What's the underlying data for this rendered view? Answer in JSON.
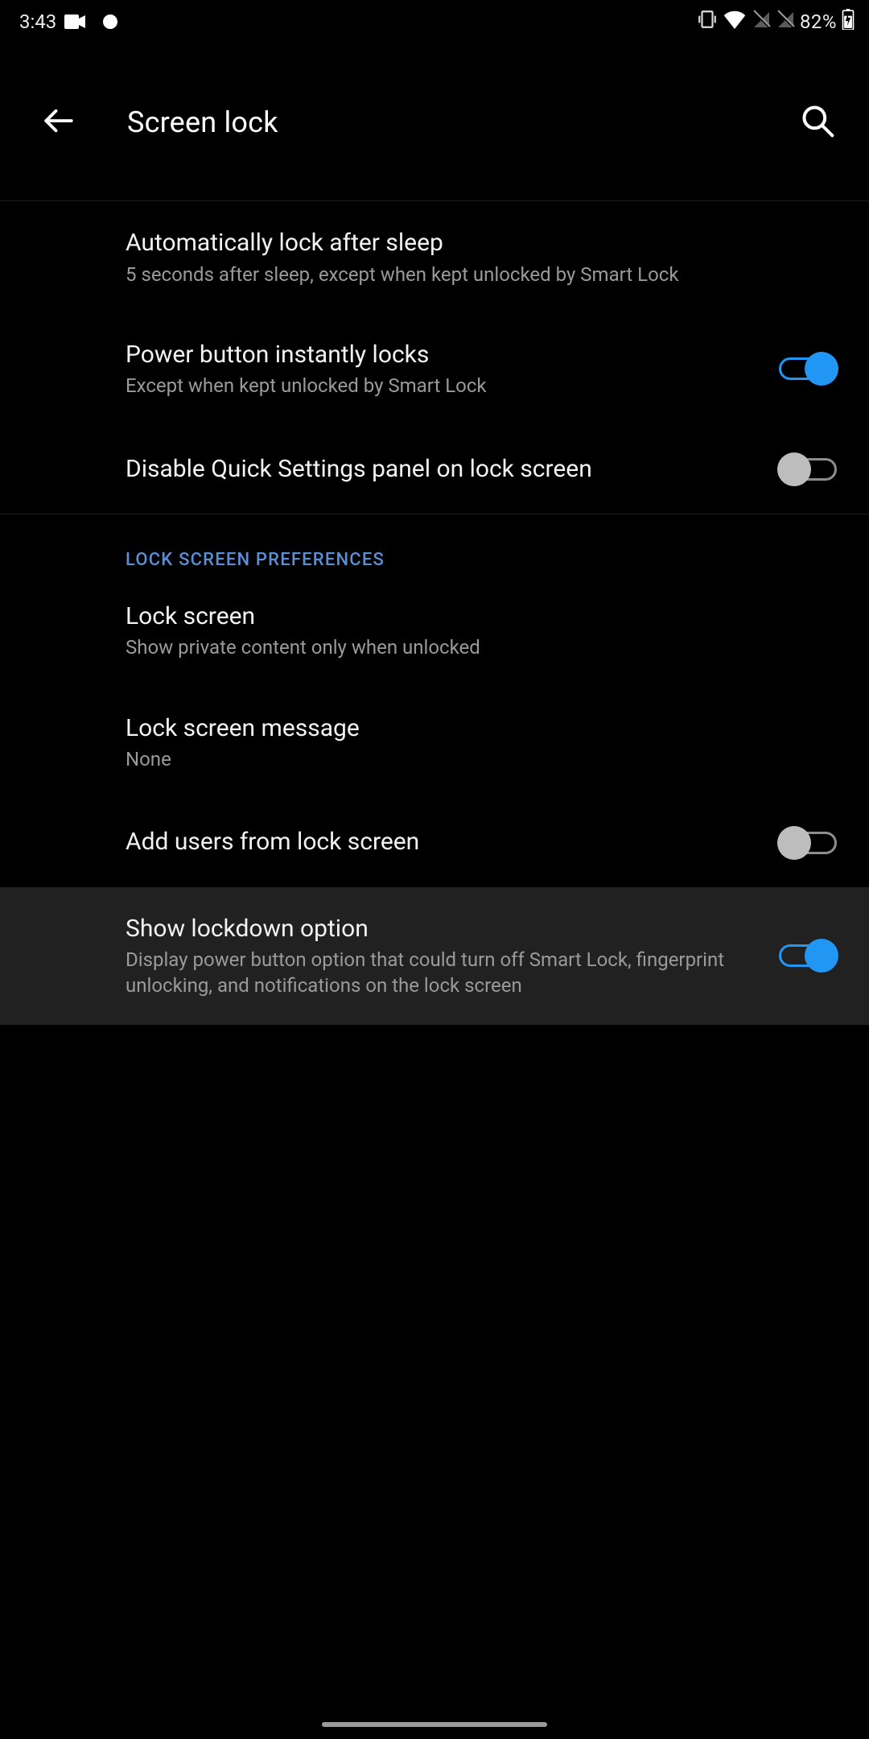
{
  "status_bar": {
    "time": "3:43",
    "battery_percent": "82%"
  },
  "header": {
    "title": "Screen lock"
  },
  "section_1": [
    {
      "title": "Automatically lock after sleep",
      "summary": "5 seconds after sleep, except when kept unlocked by Smart Lock"
    },
    {
      "title": "Power button instantly locks",
      "summary": "Except when kept unlocked by Smart Lock",
      "switch": "on"
    },
    {
      "title": "Disable Quick Settings panel on lock screen",
      "switch": "off"
    }
  ],
  "section_2_header": "LOCK SCREEN PREFERENCES",
  "section_2": [
    {
      "title": "Lock screen",
      "summary": "Show private content only when unlocked"
    },
    {
      "title": "Lock screen message",
      "summary": "None"
    },
    {
      "title": "Add users from lock screen",
      "switch": "off"
    },
    {
      "title": "Show lockdown option",
      "summary": "Display power button option that could turn off Smart Lock, fingerprint unlocking, and notifications on the lock screen",
      "switch": "on",
      "highlighted": true
    }
  ]
}
